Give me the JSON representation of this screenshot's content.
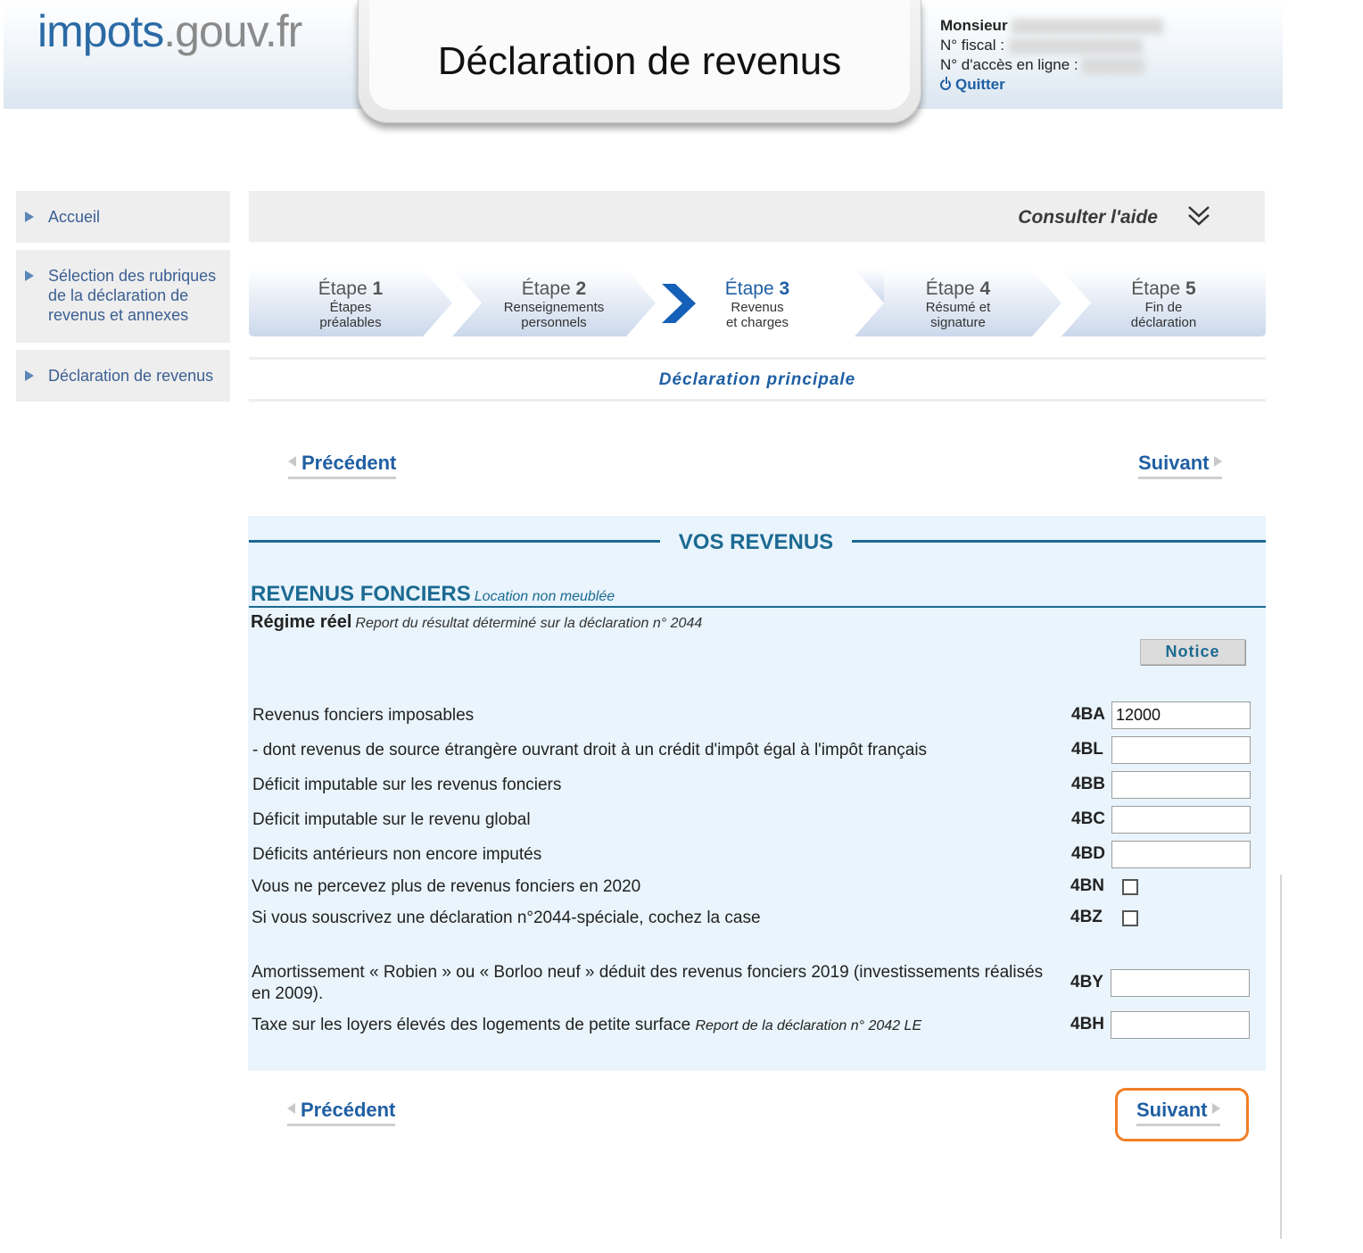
{
  "header": {
    "logo_part1": "impots",
    "logo_part2": ".gouv.fr",
    "title": "Déclaration de revenus",
    "user": {
      "name": "Monsieur",
      "fiscal_label": "N° fiscal :",
      "access_label": "N° d'accès en ligne :",
      "quit_label": "Quitter"
    }
  },
  "sidebar": {
    "items": [
      {
        "label": "Accueil"
      },
      {
        "label": "Sélection des rubriques de la déclaration de revenus et annexes"
      },
      {
        "label": "Déclaration de revenus"
      }
    ]
  },
  "help": {
    "label": "Consulter l'aide"
  },
  "steps": [
    {
      "num": "Étape",
      "n": "1",
      "line1": "Étapes",
      "line2": "préalables",
      "active": false
    },
    {
      "num": "Étape",
      "n": "2",
      "line1": "Renseignements",
      "line2": "personnels",
      "active": false
    },
    {
      "num": "Étape",
      "n": "3",
      "line1": "Revenus",
      "line2": "et charges",
      "active": true
    },
    {
      "num": "Étape",
      "n": "4",
      "line1": "Résumé et",
      "line2": "signature",
      "active": false
    },
    {
      "num": "Étape",
      "n": "5",
      "line1": "Fin de",
      "line2": "déclaration",
      "active": false
    }
  ],
  "subtitle": "Déclaration principale",
  "nav": {
    "previous": "Précédent",
    "next": "Suivant"
  },
  "form": {
    "section_title": "VOS REVENUS",
    "heading": "REVENUS FONCIERS",
    "heading_note": "Location non meublée",
    "regime": "Régime réel",
    "regime_note": "Report du résultat déterminé sur la déclaration n° 2044",
    "notice_button": "Notice",
    "rows": [
      {
        "label": "Revenus fonciers imposables",
        "code": "4BA",
        "value": "12000"
      },
      {
        "label": "- dont revenus de source étrangère ouvrant droit à un crédit d'impôt égal à l'impôt français",
        "code": "4BL",
        "value": ""
      },
      {
        "label": "Déficit imputable sur les revenus fonciers",
        "code": "4BB",
        "value": ""
      },
      {
        "label": "Déficit imputable sur le revenu global",
        "code": "4BC",
        "value": ""
      },
      {
        "label": "Déficits antérieurs non encore imputés",
        "code": "4BD",
        "value": ""
      },
      {
        "label": "Vous ne percevez plus de revenus fonciers en 2020",
        "code": "4BN",
        "checked": false
      },
      {
        "label": "Si vous souscrivez une déclaration n°2044-spéciale, cochez la case",
        "code": "4BZ",
        "checked": false
      },
      {
        "label": "Amortissement « Robien » ou « Borloo neuf » déduit des revenus fonciers 2019 (investissements réalisés en 2009).",
        "code": "4BY",
        "value": ""
      },
      {
        "label": "Taxe sur les loyers élevés des logements de petite surface",
        "note": "Report de la déclaration n° 2042 LE",
        "code": "4BH",
        "value": ""
      }
    ]
  },
  "colors": {
    "accent": "#1f5fa3",
    "section": "#1c6a92",
    "panel_bg": "#e9f4fc",
    "highlight": "#f27e25"
  }
}
